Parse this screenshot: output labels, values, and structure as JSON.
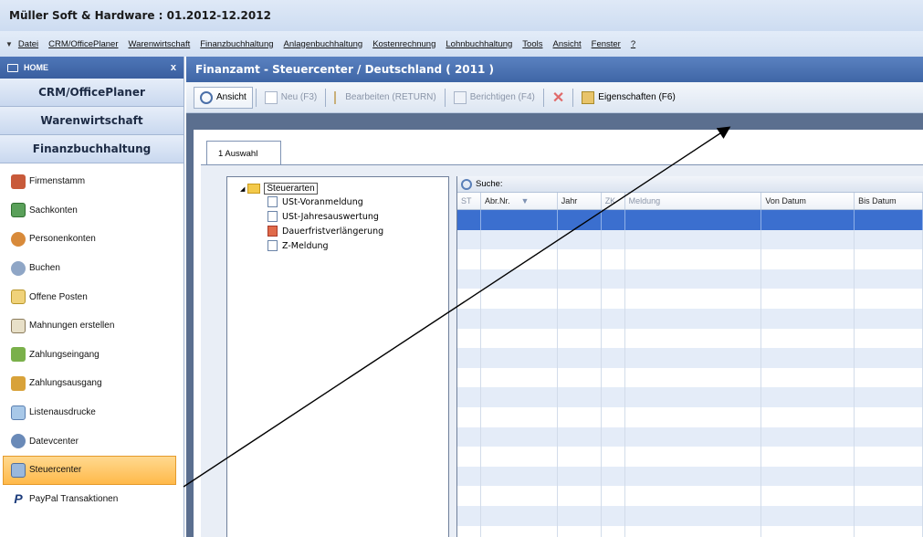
{
  "window": {
    "title": "Müller Soft & Hardware : 01.2012-12.2012"
  },
  "menu": {
    "items": [
      "Datei",
      "CRM/OfficePlaner",
      "Warenwirtschaft",
      "Finanzbuchhaltung",
      "Anlagenbuchhaltung",
      "Kostenrechnung",
      "Lohnbuchhaltung",
      "Tools",
      "Ansicht",
      "Fenster",
      "?"
    ]
  },
  "nav": {
    "header": "HOME",
    "close": "x",
    "sections": [
      "CRM/OfficePlaner",
      "Warenwirtschaft",
      "Finanzbuchhaltung"
    ],
    "items": [
      "Firmenstamm",
      "Sachkonten",
      "Personenkonten",
      "Buchen",
      "Offene Posten",
      "Mahnungen erstellen",
      "Zahlungseingang",
      "Zahlungsausgang",
      "Listenausdrucke",
      "Datevcenter",
      "Steuercenter",
      "PayPal Transaktionen"
    ],
    "active_item": "Steuercenter"
  },
  "content": {
    "title": "Finanzamt - Steuercenter / Deutschland ( 2011 )",
    "toolbar": {
      "ansicht": "Ansicht",
      "neu": "Neu (F3)",
      "bearbeiten": "Bearbeiten (RETURN)",
      "berichtigen": "Berichtigen (F4)",
      "eigenschaften": "Eigenschaften (F6)"
    },
    "tab": "1 Auswahl",
    "tree": {
      "root": "Steuerarten",
      "children": [
        "USt-Voranmeldung",
        "USt-Jahresauswertung",
        "Dauerfristverlängerung",
        "Z-Meldung"
      ]
    },
    "grid": {
      "search_label": "Suche:",
      "columns": [
        "ST",
        "Abr.Nr.",
        "Jahr",
        "ZK",
        "Meldung",
        "Von Datum",
        "Bis Datum"
      ]
    }
  },
  "colors": {
    "header_blue": "#3f66a6",
    "selection_blue": "#3b6fcf",
    "active_orange": "#ffb94a"
  }
}
